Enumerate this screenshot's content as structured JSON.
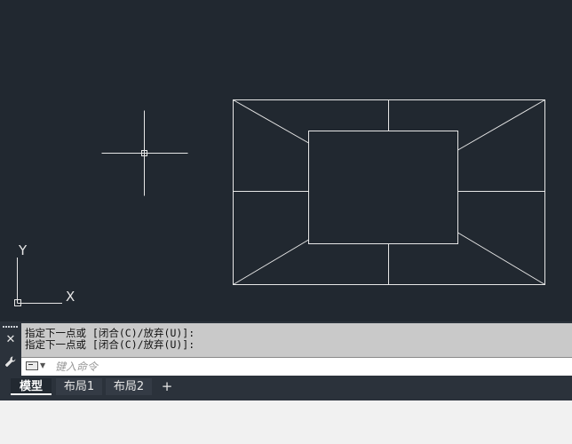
{
  "canvas": {
    "background": "#212830",
    "line_color": "#e6e6e6",
    "ucs_x_label": "X",
    "ucs_y_label": "Y"
  },
  "command_line": {
    "history": [
      "指定下一点或 [闭合(C)/放弃(U)]:",
      "指定下一点或 [闭合(C)/放弃(U)]:"
    ],
    "input_placeholder": "键入命令",
    "input_value": "",
    "prompt_icon": "command-prompt-icon",
    "close_icon": "close-icon",
    "customize_icon": "wrench-icon"
  },
  "layout_tabs": {
    "tabs": [
      "模型",
      "布局1",
      "布局2"
    ],
    "active_tab": "模型",
    "add_icon": "plus-icon"
  }
}
